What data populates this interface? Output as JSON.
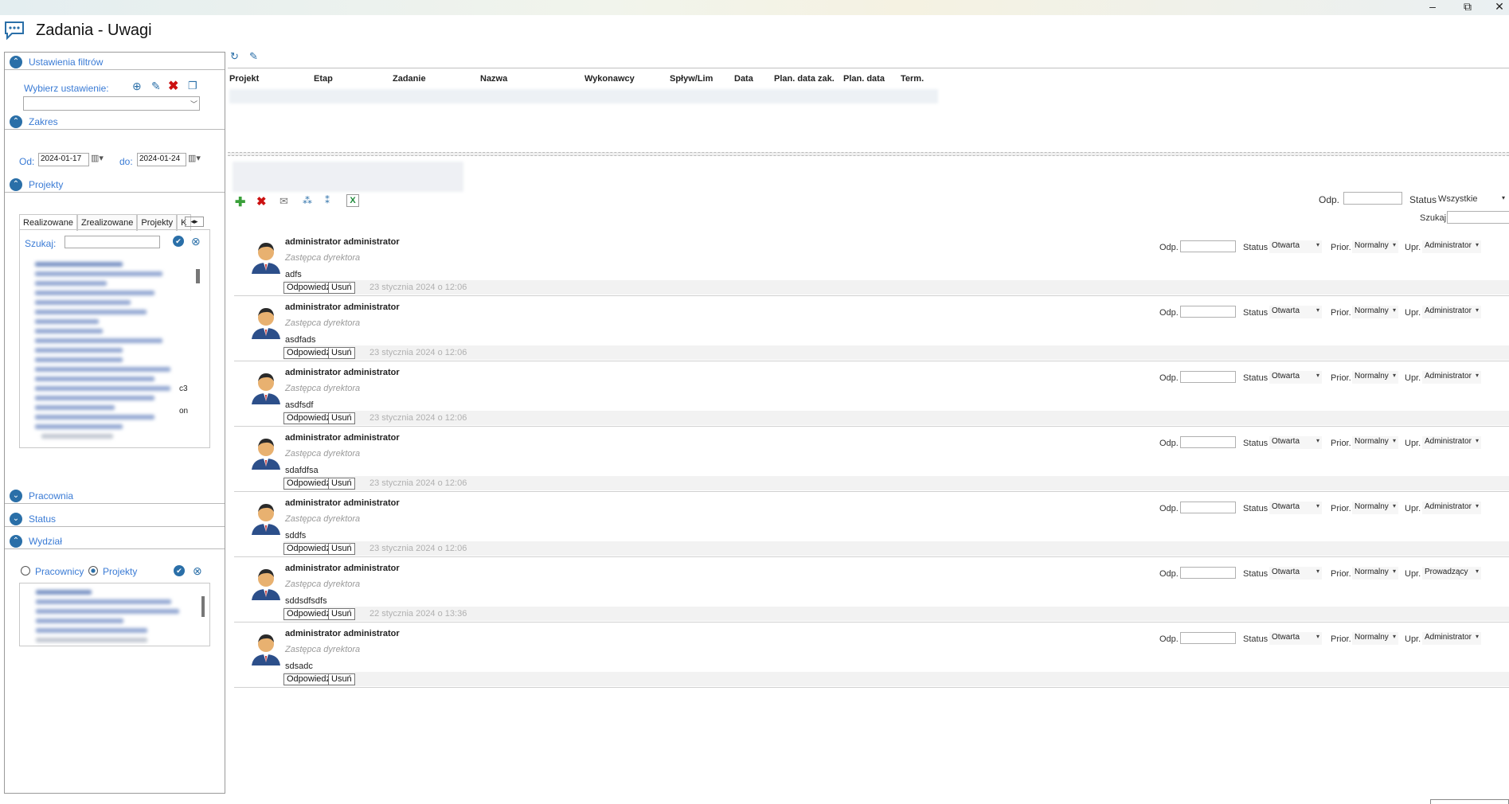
{
  "window": {
    "title": "Zadania - Uwagi",
    "minimize": "–",
    "restore": "⧉",
    "close": "✕"
  },
  "filters": {
    "settings_section": "Ustawienia filtrów",
    "choose_label": "Wybierz ustawienie:",
    "range_section": "Zakres",
    "from_label": "Od:",
    "from_value": "2024-01-17",
    "to_label": "do:",
    "to_value": "2024-01-24",
    "projects_section": "Projekty",
    "tabs": [
      "Realizowane",
      "Zrealizowane",
      "Projekty",
      "K"
    ],
    "search_label": "Szukaj:",
    "partial_texts": [
      "c3",
      "on"
    ],
    "pracownia_section": "Pracownia",
    "status_section": "Status",
    "wydzial_section": "Wydział",
    "radio_employees": "Pracownicy",
    "radio_projects": "Projekty"
  },
  "grid": {
    "columns": [
      "Projekt",
      "Etap",
      "Zadanie",
      "Nazwa",
      "Wykonawcy",
      "Spływ/Lim",
      "Data",
      "Plan. data zak.",
      "Plan. data",
      "Term."
    ]
  },
  "notes_toolbar": {
    "odp_label": "Odp.",
    "status_label": "Status",
    "status_value": "Wszystkie",
    "search_label": "Szukaj"
  },
  "note_labels": {
    "odp": "Odp.",
    "status": "Status",
    "prior": "Prior.",
    "upr": "Upr.",
    "reply_button": "Odpowiedź",
    "delete_button": "Usuń"
  },
  "notes": [
    {
      "author": "administrator  administrator",
      "role": "Zastępca dyrektora",
      "text": "adfs",
      "date": "23 stycznia 2024 o 12:06",
      "status": "Otwarta",
      "priority": "Normalny",
      "upr": "Administrator"
    },
    {
      "author": "administrator  administrator",
      "role": "Zastępca dyrektora",
      "text": "asdfads",
      "date": "23 stycznia 2024 o 12:06",
      "status": "Otwarta",
      "priority": "Normalny",
      "upr": "Administrator"
    },
    {
      "author": "administrator  administrator",
      "role": "Zastępca dyrektora",
      "text": "asdfsdf",
      "date": "23 stycznia 2024 o 12:06",
      "status": "Otwarta",
      "priority": "Normalny",
      "upr": "Administrator"
    },
    {
      "author": "administrator  administrator",
      "role": "Zastępca dyrektora",
      "text": "sdafdfsa",
      "date": "23 stycznia 2024 o 12:06",
      "status": "Otwarta",
      "priority": "Normalny",
      "upr": "Administrator"
    },
    {
      "author": "administrator  administrator",
      "role": "Zastępca dyrektora",
      "text": "sddfs",
      "date": "23 stycznia 2024 o 12:06",
      "status": "Otwarta",
      "priority": "Normalny",
      "upr": "Administrator"
    },
    {
      "author": "administrator  administrator",
      "role": "Zastępca dyrektora",
      "text": "sddsdfsdfs",
      "date": "22 stycznia 2024 o 13:36",
      "status": "Otwarta",
      "priority": "Normalny",
      "upr": "Prowadzący"
    },
    {
      "author": "administrator  administrator",
      "role": "Zastępca dyrektora",
      "text": "sdsadc",
      "date": "",
      "status": "Otwarta",
      "priority": "Normalny",
      "upr": "Administrator"
    }
  ],
  "colors": {
    "accent": "#3a7bd5",
    "toggle": "#2a6fa8",
    "delete": "#cc1111",
    "add": "#3aa03a"
  }
}
